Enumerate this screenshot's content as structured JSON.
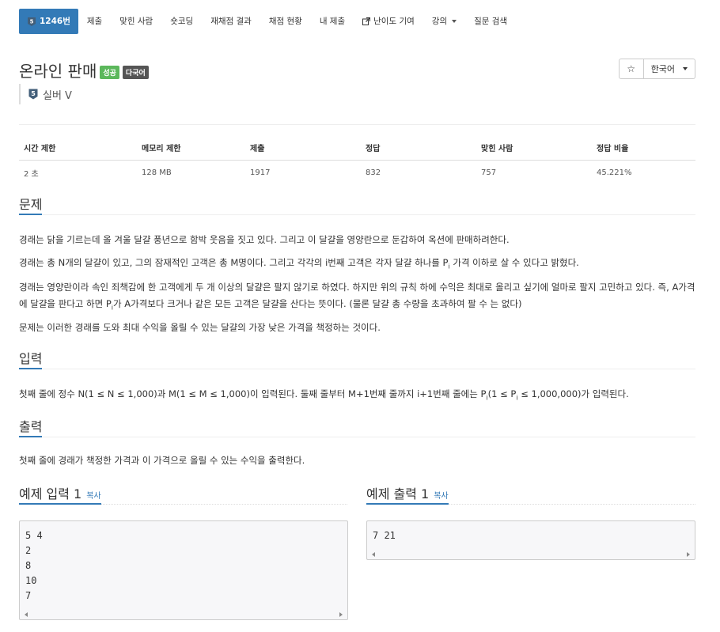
{
  "nav": {
    "tabs": [
      {
        "label": "1246번"
      },
      {
        "label": "제출"
      },
      {
        "label": "맞힌 사람"
      },
      {
        "label": "숏코딩"
      },
      {
        "label": "재채점 결과"
      },
      {
        "label": "채점 현황"
      },
      {
        "label": "내 제출"
      },
      {
        "label": "난이도 기여"
      },
      {
        "label": "강의"
      },
      {
        "label": "질문 검색"
      }
    ]
  },
  "problem": {
    "title": "온라인 판매",
    "badge_success": "성공",
    "badge_multilang": "다국어",
    "tier": "실버 V",
    "tier_num": "5"
  },
  "toolbar": {
    "star": "☆",
    "language": "한국어"
  },
  "stats": {
    "headers": [
      "시간 제한",
      "메모리 제한",
      "제출",
      "정답",
      "맞힌 사람",
      "정답 비율"
    ],
    "values": [
      "2 초",
      "128 MB",
      "1917",
      "832",
      "757",
      "45.221%"
    ]
  },
  "sections": {
    "problem_h": "문제",
    "p1": "경래는 닭을 기르는데 올 겨울 달걀 풍년으로 함박 웃음을 짓고 있다. 그리고 이 달걀을 영양란으로 둔갑하여 옥션에 판매하려한다.",
    "p2a": "경래는 총 N개의 달걀이 있고, 그의 잠재적인 고객은 총 M명이다. 그리고 각각의 i번째 고객은 각자 달걀 하나를 P",
    "p2b": " 가격 이하로 살 수 있다고 밝혔다.",
    "p3a": "경래는 영양란이라 속인 죄책감에 한 고객에게 두 개 이상의 달걀은 팔지 않기로 하였다. 하지만 위의 규칙 하에 수익은 최대로 올리고 싶기에 얼마로 팔지 고민하고 있다. 즉, A가격에 달걀을 판다고 하면 P",
    "p3b": "가 A가격보다 크거나 같은 모든 고객은 달걀을 산다는 뜻이다. (물론 달걀 총 수량을 초과하여 팔 수 는 없다)",
    "p4": "문제는 이러한 경래를 도와 최대 수익을 올릴 수 있는 달걀의 가장 낮은 가격을 책정하는 것이다.",
    "input_h": "입력",
    "in_a": "첫째 줄에 정수 N(1 ≤ N ≤ 1,000)과 M(1 ≤ M ≤ 1,000)이 입력된다. 둘째 줄부터 M+1번째 줄까지 i+1번째 줄에는 P",
    "in_b": "(1 ≤ P",
    "in_c": " ≤ 1,000,000)가 입력된다.",
    "output_h": "출력",
    "out": "첫째 줄에 경래가 책정한 가격과 이 가격으로 올릴 수 있는 수익을 출력한다.",
    "sub_i": "i"
  },
  "samples": {
    "input_title": "예제 입력 1",
    "output_title": "예제 출력 1",
    "copy": "복사",
    "input": "5 4\n2\n8\n10\n7",
    "output": "7 21"
  },
  "colors": {
    "accent": "#337ab7",
    "success": "#5cb85c",
    "multilang": "#555555"
  }
}
